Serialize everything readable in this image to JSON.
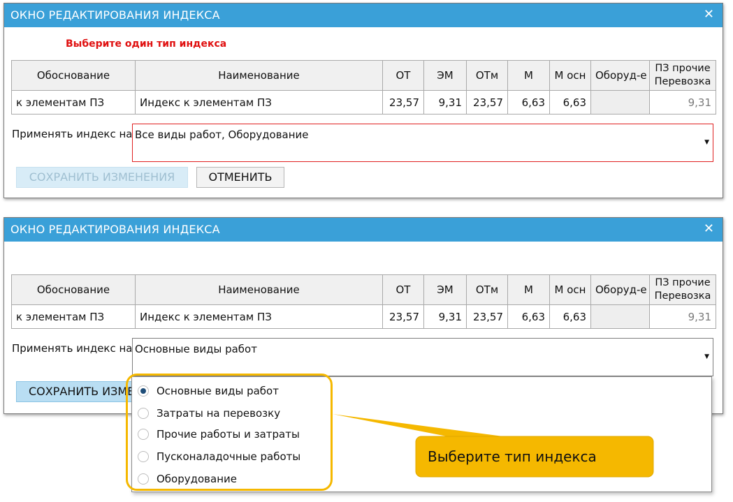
{
  "window_title": "ОКНО РЕДАКТИРОВАНИЯ ИНДЕКСА",
  "close_glyph": "✕",
  "warning": "Выберите один тип индекса",
  "table": {
    "headers": [
      "Обоснование",
      "Наименование",
      "ОТ",
      "ЭМ",
      "ОТм",
      "М",
      "М осн",
      "Оборуд-е",
      "ПЗ прочие Перевозка"
    ],
    "row": [
      "к элементам ПЗ",
      "Индекс к элементам ПЗ",
      "23,57",
      "9,31",
      "23,57",
      "6,63",
      "6,63",
      "",
      "9,31"
    ]
  },
  "apply_label": "Применять индекс на:",
  "window1": {
    "apply_value": "Все виды работ, Оборудование",
    "save_label": "СОХРАНИТЬ ИЗМЕНЕНИЯ",
    "cancel_label": "ОТМЕНИТЬ"
  },
  "window2": {
    "apply_value": "Основные виды работ",
    "save_label": "СОХРАНИТЬ ИЗМЕ"
  },
  "dropdown": {
    "options": [
      {
        "label": "Основные виды работ",
        "selected": true
      },
      {
        "label": "Затраты на перевозку",
        "selected": false
      },
      {
        "label": "Прочие работы и затраты",
        "selected": false
      },
      {
        "label": "Пусконаладочные работы",
        "selected": false
      },
      {
        "label": "Оборудование",
        "selected": false
      }
    ]
  },
  "callout": {
    "text": "Выберите тип индекса",
    "color": "#f5b800"
  },
  "colors": {
    "titlebar": "#3aa0d8",
    "warning": "#e01010",
    "accent_highlight": "#f5b800"
  }
}
